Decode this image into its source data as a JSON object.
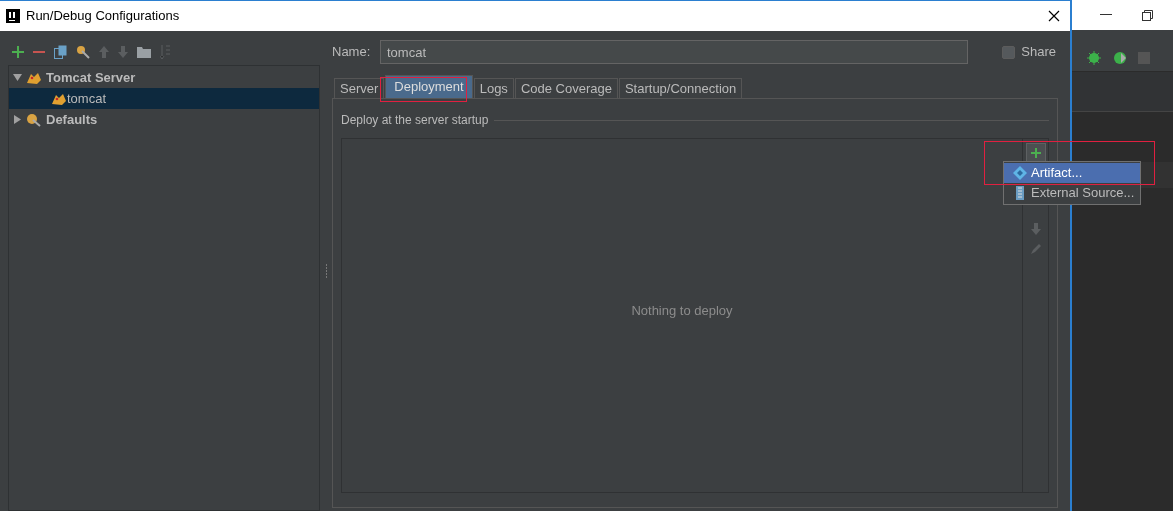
{
  "window": {
    "title": "Run/Debug Configurations"
  },
  "tree": [
    {
      "label": "Tomcat Server",
      "expanded": true,
      "selected": false,
      "children": [
        {
          "label": "tomcat",
          "selected": true
        }
      ]
    },
    {
      "label": "Defaults",
      "expanded": false,
      "selected": false
    }
  ],
  "name_field": {
    "label": "Name:",
    "value": "tomcat"
  },
  "share": {
    "label": "Share",
    "checked": false
  },
  "tabs": [
    {
      "label": "Server",
      "selected": false
    },
    {
      "label": "Deployment",
      "selected": true
    },
    {
      "label": "Logs",
      "selected": false
    },
    {
      "label": "Code Coverage",
      "selected": false
    },
    {
      "label": "Startup/Connection",
      "selected": false
    }
  ],
  "deployment": {
    "group_title": "Deploy at the server startup",
    "empty_text": "Nothing to deploy"
  },
  "add_menu": {
    "items": [
      {
        "label": "Artifact...",
        "selected": true
      },
      {
        "label": "External Source...",
        "selected": false
      }
    ]
  }
}
